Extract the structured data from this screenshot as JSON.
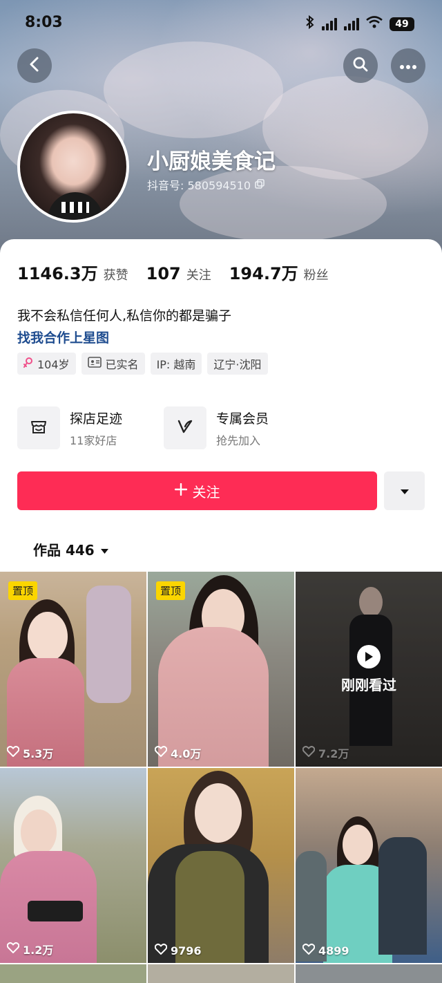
{
  "status_bar": {
    "time": "8:03",
    "battery": "49"
  },
  "profile": {
    "name": "小厨娘美食记",
    "douyin_id": "抖音号: 580594510",
    "stats": [
      {
        "value": "1146.3万",
        "label": "获赞"
      },
      {
        "value": "107",
        "label": "关注"
      },
      {
        "value": "194.7万",
        "label": "粉丝"
      }
    ],
    "bio": "我不会私信任何人,私信你的都是骗子",
    "bio_link": "找我合作上星图",
    "tags": {
      "age": "104岁",
      "verified": "已实名",
      "ip": "IP: 越南",
      "location": "辽宁·沈阳"
    }
  },
  "services": {
    "shop": {
      "title": "探店足迹",
      "subtitle": "11家好店"
    },
    "vip": {
      "title": "专属会员",
      "subtitle": "抢先加入"
    }
  },
  "actions": {
    "follow_label": "关注",
    "follow_icon": "plus-icon",
    "dropdown_icon": "triangle-down-icon"
  },
  "works_tab": {
    "label": "作品 446"
  },
  "videos": [
    {
      "badge": "置顶",
      "likes": "5.3万"
    },
    {
      "badge": "置顶",
      "likes": "4.0万"
    },
    {
      "likes": "7.2万",
      "overlay": "刚刚看过"
    },
    {
      "likes": "1.2万"
    },
    {
      "likes": "9796"
    },
    {
      "likes": "4899"
    }
  ],
  "colors": {
    "accent": "#fe2c55",
    "link": "#1e4c8f",
    "pin_badge": "#fbd500"
  }
}
